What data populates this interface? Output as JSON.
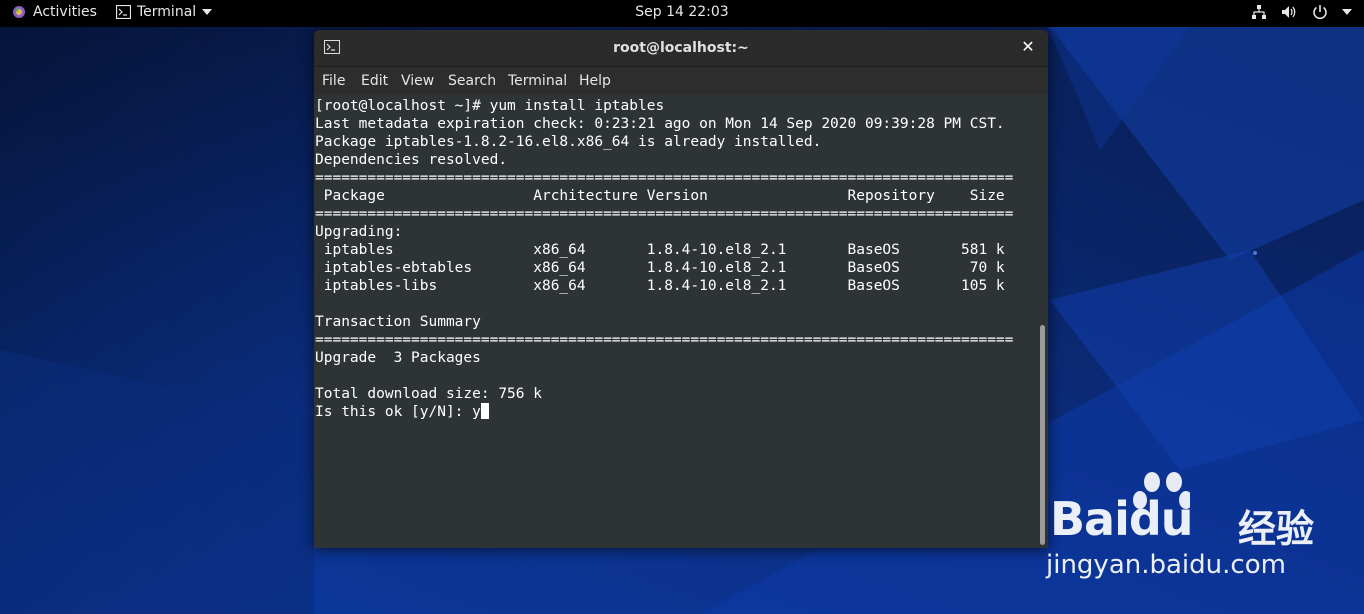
{
  "topbar": {
    "activities_label": "Activities",
    "app_menu_label": "Terminal",
    "clock": "Sep 14  22:03",
    "tray_icons": [
      "network-icon",
      "volume-icon",
      "power-icon"
    ]
  },
  "window": {
    "title": "root@localhost:~",
    "close_glyph": "✕",
    "menu": [
      "File",
      "Edit",
      "View",
      "Search",
      "Terminal",
      "Help"
    ]
  },
  "terminal": {
    "lines": [
      "[root@localhost ~]# yum install iptables",
      "Last metadata expiration check: 0:23:21 ago on Mon 14 Sep 2020 09:39:28 PM CST.",
      "Package iptables-1.8.2-16.el8.x86_64 is already installed.",
      "Dependencies resolved.",
      "================================================================================",
      " Package                 Architecture Version                Repository    Size",
      "================================================================================",
      "Upgrading:",
      " iptables                x86_64       1.8.4-10.el8_2.1       BaseOS       581 k",
      " iptables-ebtables       x86_64       1.8.4-10.el8_2.1       BaseOS        70 k",
      " iptables-libs           x86_64       1.8.4-10.el8_2.1       BaseOS       105 k",
      "",
      "Transaction Summary",
      "================================================================================",
      "Upgrade  3 Packages",
      "",
      "Total download size: 756 k"
    ],
    "prompt_line": "Is this ok [y/N]: y"
  },
  "watermark": {
    "logo_text": "Baidu",
    "logo_cn": "经验",
    "url": "jingyan.baidu.com"
  },
  "colors": {
    "terminal_bg": "#2e3436",
    "terminal_fg": "#ffffff",
    "topbar_bg": "#000000",
    "desktop_blue": "#0c2f86"
  }
}
